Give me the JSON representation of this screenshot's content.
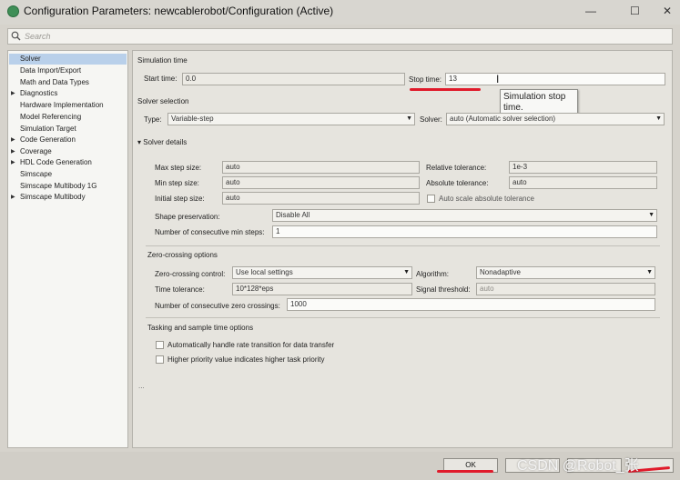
{
  "window": {
    "title": "Configuration Parameters: newcablerobot/Configuration (Active)",
    "minimize_glyph": "—",
    "maximize_glyph": "☐",
    "close_glyph": "✕"
  },
  "search": {
    "placeholder": "Search"
  },
  "sidebar": {
    "items": [
      {
        "label": "Solver",
        "selected": true,
        "expandable": false
      },
      {
        "label": "Data Import/Export",
        "expandable": false
      },
      {
        "label": "Math and Data Types",
        "expandable": false
      },
      {
        "label": "Diagnostics",
        "expandable": true
      },
      {
        "label": "Hardware Implementation",
        "expandable": false
      },
      {
        "label": "Model Referencing",
        "expandable": false
      },
      {
        "label": "Simulation Target",
        "expandable": false
      },
      {
        "label": "Code Generation",
        "expandable": true
      },
      {
        "label": "Coverage",
        "expandable": true
      },
      {
        "label": "HDL Code Generation",
        "expandable": true
      },
      {
        "label": "Simscape",
        "expandable": false
      },
      {
        "label": "Simscape Multibody 1G",
        "expandable": false
      },
      {
        "label": "Simscape Multibody",
        "expandable": true
      }
    ]
  },
  "simulation_time": {
    "section_label": "Simulation time",
    "start_label": "Start time:",
    "start_value": "0.0",
    "stop_label": "Stop time:",
    "stop_value": "13",
    "tooltip": "Simulation stop time."
  },
  "solver_selection": {
    "section_label": "Solver selection",
    "type_label": "Type:",
    "type_value": "Variable-step",
    "solver_label": "Solver:",
    "solver_value": "auto (Automatic solver selection)"
  },
  "solver_details": {
    "section_label": "Solver details",
    "max_step_label": "Max step size:",
    "max_step_value": "auto",
    "min_step_label": "Min step size:",
    "min_step_value": "auto",
    "initial_step_label": "Initial step size:",
    "initial_step_value": "auto",
    "rel_tol_label": "Relative tolerance:",
    "rel_tol_value": "1e-3",
    "abs_tol_label": "Absolute tolerance:",
    "abs_tol_value": "auto",
    "auto_scale_label": "Auto scale absolute tolerance",
    "shape_label": "Shape preservation:",
    "shape_value": "Disable All",
    "consec_min_label": "Number of consecutive min steps:",
    "consec_min_value": "1"
  },
  "zero_crossing": {
    "section_label": "Zero-crossing options",
    "control_label": "Zero-crossing control:",
    "control_value": "Use local settings",
    "algorithm_label": "Algorithm:",
    "algorithm_value": "Nonadaptive",
    "time_tol_label": "Time tolerance:",
    "time_tol_value": "10*128*eps",
    "signal_thr_label": "Signal threshold:",
    "signal_thr_value": "auto",
    "consec_zero_label": "Number of consecutive zero crossings:",
    "consec_zero_value": "1000"
  },
  "tasking": {
    "section_label": "Tasking and sample time options",
    "rate_transition_label": "Automatically handle rate transition for data transfer",
    "priority_label": "Higher priority value indicates higher task priority"
  },
  "more_ellipsis": "...",
  "buttons": {
    "ok_label": "OK"
  },
  "watermark": "CSDN @Robot_张",
  "colors": {
    "annotation_red": "#e01a2a",
    "selection": "#b9d0ea"
  }
}
